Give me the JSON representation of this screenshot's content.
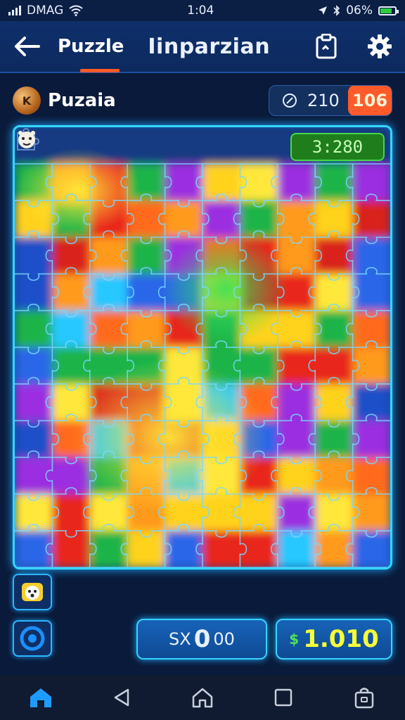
{
  "status_bar": {
    "carrier": "DMAG",
    "time": "1:04",
    "battery": "06%"
  },
  "app_bar": {
    "tab_label": "Puzzle",
    "title": "Iinparzian"
  },
  "header": {
    "game_name": "Puzaia",
    "moves": "210",
    "badge": "106"
  },
  "board": {
    "timer": "3:280",
    "columns": 10,
    "rows": 11
  },
  "bottom": {
    "score_prefix": "SX",
    "score_big": "0",
    "score_suffix": "00",
    "coins": "1.010",
    "coin_symbol": "$"
  },
  "colors": {
    "accent": "#35d6ff",
    "badge": "#ff5a2a",
    "timer_bg": "#1f7d1c",
    "coin_text": "#f7ff3a"
  },
  "icons": [
    "back-arrow-icon",
    "clipboard-icon",
    "gear-icon",
    "compass-icon",
    "home-icon",
    "back-icon",
    "square-icon",
    "bag-icon"
  ]
}
